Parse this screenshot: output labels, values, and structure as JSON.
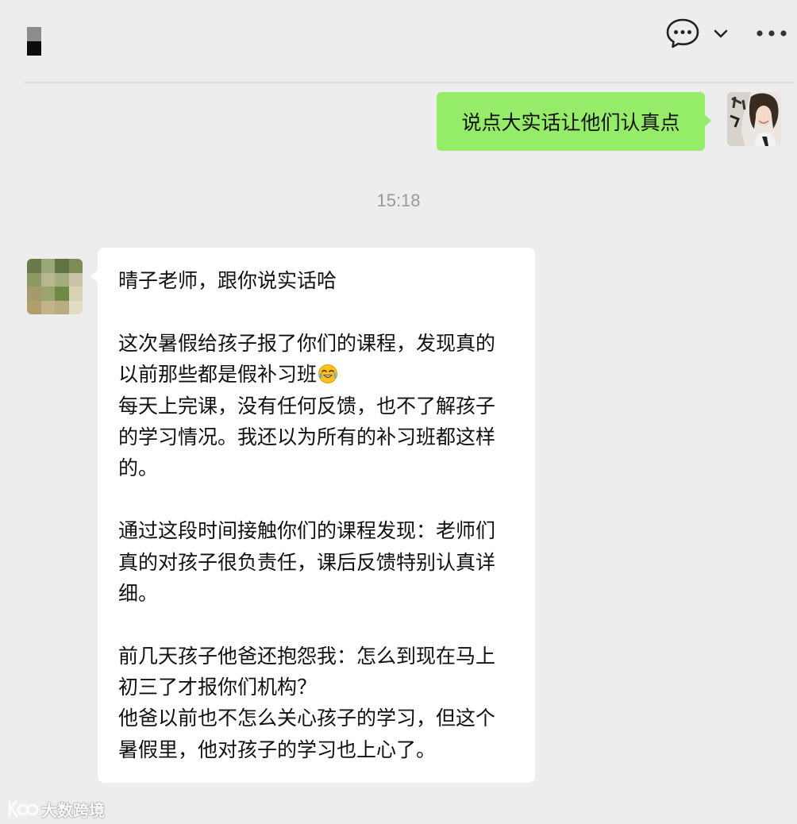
{
  "header": {
    "title_redacted": true,
    "icons": [
      "chat-bubble-icon",
      "chevron-down-icon",
      "more-icon"
    ]
  },
  "messages": {
    "outgoing": {
      "text": "说点大实话让他们认真点"
    },
    "timestamp": "15:18",
    "incoming": {
      "paragraphs": [
        [
          "晴子老师，跟你说实话哈"
        ],
        [
          "这次暑假给孩子报了你们的课程，发现真的",
          "以前那些都是假补习班",
          "每天上完课，没有任何反馈，也不了解孩子",
          "的学习情况。我还以为所有的补习班都这样",
          "的。"
        ],
        [
          "通过这段时间接触你们的课程发现：老师们",
          "真的对孩子很负责任，课后反馈特别认真详",
          "细。"
        ],
        [
          "前几天孩子他爸还抱怨我：怎么到现在马上",
          "初三了才报你们机构？",
          "他爸以前也不怎么关心孩子的学习，但这个",
          "暑假里，他对孩子的学习也上心了。"
        ]
      ],
      "emoji": "crying-laughing-emoji"
    }
  },
  "watermark": {
    "text": "大数跨境"
  },
  "colors": {
    "background": "#ededed",
    "outgoing_bubble": "#95ec69",
    "incoming_bubble": "#ffffff",
    "timestamp": "#9a9a9a"
  }
}
